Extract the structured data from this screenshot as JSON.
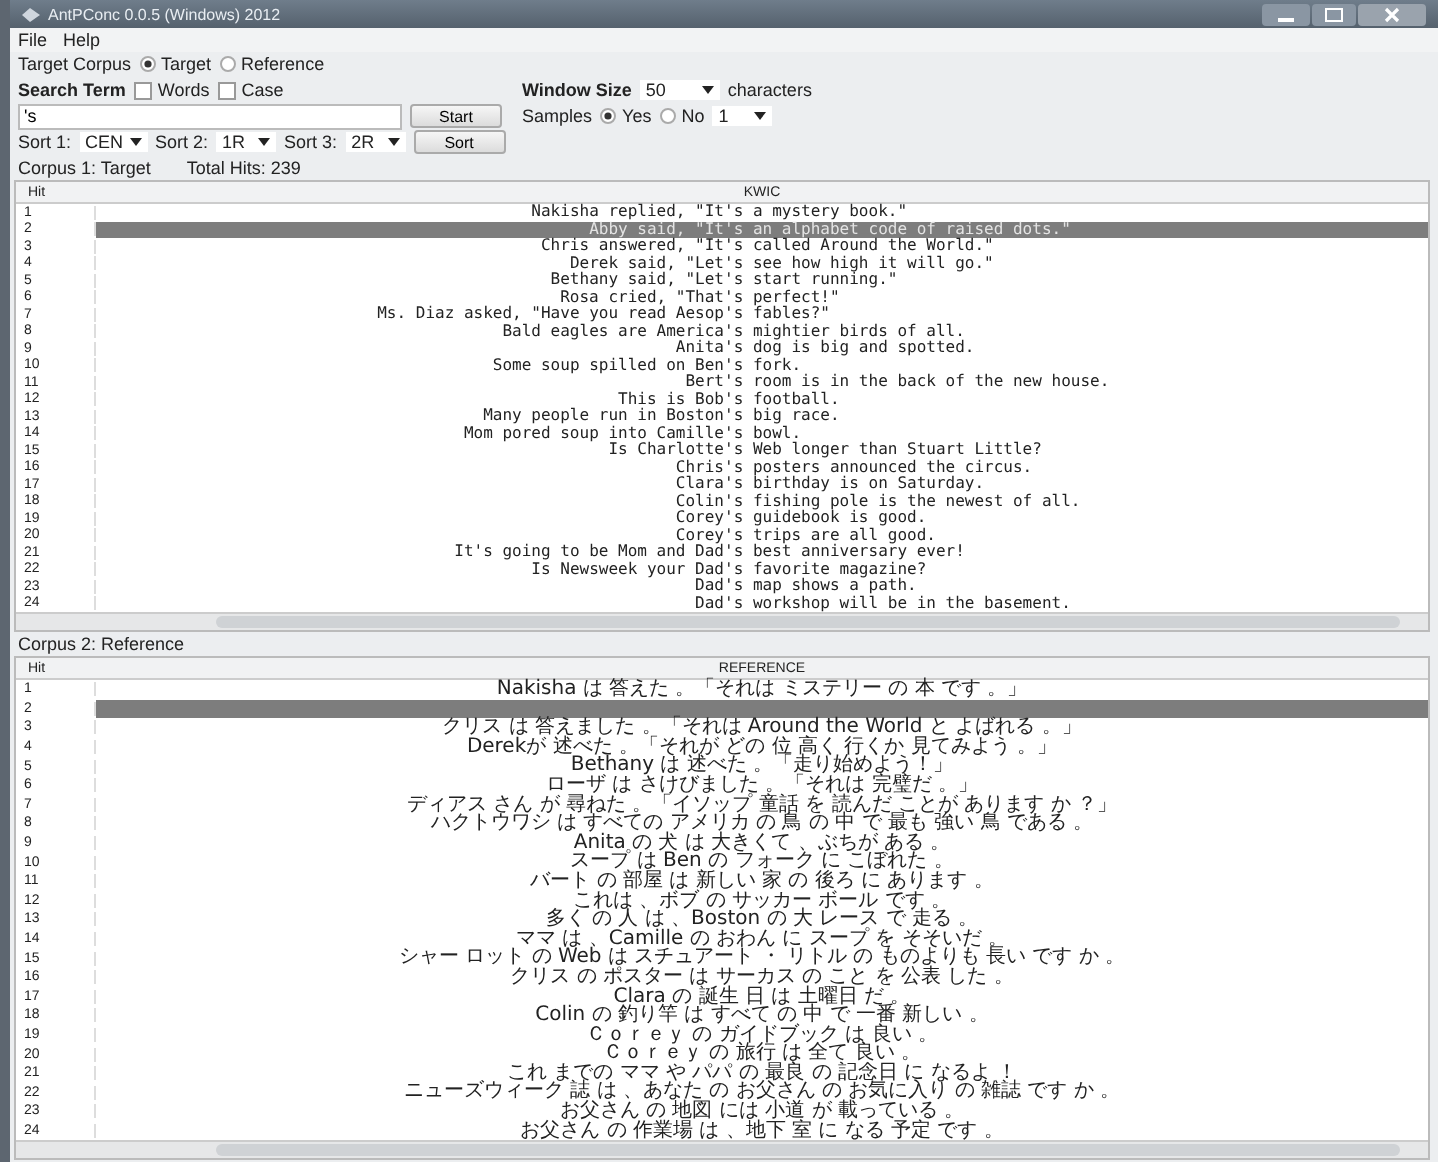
{
  "window": {
    "title": "AntPConc 0.0.5 (Windows) 2012"
  },
  "menu": [
    "File",
    "Help"
  ],
  "target_corpus": {
    "label": "Target Corpus",
    "options": [
      {
        "label": "Target",
        "selected": true
      },
      {
        "label": "Reference",
        "selected": false
      }
    ]
  },
  "search_term": {
    "label": "Search Term",
    "options": [
      {
        "label": "Words",
        "checked": false
      },
      {
        "label": "Case",
        "checked": false
      }
    ],
    "value": "'s"
  },
  "window_size": {
    "label": "Window Size",
    "value": "50",
    "unit": "characters"
  },
  "samples": {
    "label": "Samples",
    "options": [
      {
        "label": "Yes",
        "selected": true
      },
      {
        "label": "No",
        "selected": false
      }
    ],
    "value": "1"
  },
  "start_button": "Start",
  "sort_button": "Sort",
  "sorts": [
    {
      "label": "Sort 1:",
      "value": "CEN"
    },
    {
      "label": "Sort 2:",
      "value": "1R"
    },
    {
      "label": "Sort 3:",
      "value": "2R"
    }
  ],
  "corpus1": {
    "label": "Corpus 1: Target",
    "total_hits": "Total Hits: 239",
    "columns": [
      "Hit",
      "KWIC"
    ],
    "rows": [
      {
        "hit": "1",
        "left": "Nakisha replied, \"It",
        "right": "'s a mystery book.\"",
        "selected": false
      },
      {
        "hit": "2",
        "left": "Abby said, \"It",
        "right": "'s an alphabet code of raised dots.\"",
        "selected": true
      },
      {
        "hit": "3",
        "left": "Chris answered, \"It",
        "right": "'s called Around the World.\"",
        "selected": false
      },
      {
        "hit": "4",
        "left": "Derek said, \"Let",
        "right": "'s see how high it will go.\"",
        "selected": false
      },
      {
        "hit": "5",
        "left": "Bethany said, \"Let",
        "right": "'s start running.\"",
        "selected": false
      },
      {
        "hit": "6",
        "left": "Rosa cried, \"That",
        "right": "'s perfect!\"",
        "selected": false
      },
      {
        "hit": "7",
        "left": "Ms. Diaz asked, \"Have you read Aesop",
        "right": "'s fables?\"",
        "selected": false
      },
      {
        "hit": "8",
        "left": "Bald eagles are America",
        "right": "'s mightier birds of all.",
        "selected": false
      },
      {
        "hit": "9",
        "left": "Anita",
        "right": "'s dog is big and spotted.",
        "selected": false
      },
      {
        "hit": "10",
        "left": "Some soup spilled on Ben",
        "right": "'s fork.",
        "selected": false
      },
      {
        "hit": "11",
        "left": "Bert",
        "right": "'s room is in the back of the new house.",
        "selected": false
      },
      {
        "hit": "12",
        "left": "This is Bob",
        "right": "'s football.",
        "selected": false
      },
      {
        "hit": "13",
        "left": "Many people run in Boston",
        "right": "'s big race.",
        "selected": false
      },
      {
        "hit": "14",
        "left": "Mom pored soup into Camille",
        "right": "'s bowl.",
        "selected": false
      },
      {
        "hit": "15",
        "left": "Is Charlotte",
        "right": "'s Web longer than Stuart Little?",
        "selected": false
      },
      {
        "hit": "16",
        "left": "Chris",
        "right": "'s posters announced the circus.",
        "selected": false
      },
      {
        "hit": "17",
        "left": "Clara",
        "right": "'s birthday is on Saturday.",
        "selected": false
      },
      {
        "hit": "18",
        "left": "Colin",
        "right": "'s fishing pole is the newest of all.",
        "selected": false
      },
      {
        "hit": "19",
        "left": "Corey",
        "right": "'s guidebook is good.",
        "selected": false
      },
      {
        "hit": "20",
        "left": "Corey",
        "right": "'s trips are all good.",
        "selected": false
      },
      {
        "hit": "21",
        "left": "It's going to be Mom and Dad",
        "right": "'s best anniversary ever!",
        "selected": false
      },
      {
        "hit": "22",
        "left": "Is Newsweek your Dad",
        "right": "'s favorite magazine?",
        "selected": false
      },
      {
        "hit": "23",
        "left": "Dad",
        "right": "'s map shows a path.",
        "selected": false
      },
      {
        "hit": "24",
        "left": "Dad",
        "right": "'s workshop will be in the basement.",
        "selected": false
      }
    ]
  },
  "corpus2": {
    "label": "Corpus 2: Reference",
    "columns": [
      "Hit",
      "REFERENCE"
    ],
    "rows": [
      {
        "hit": "1",
        "text": "Nakisha は 答えた 。「それは ミステリー の 本 です 。」",
        "selected": false
      },
      {
        "hit": "2",
        "selected": true
      },
      {
        "hit": "3",
        "text": "クリス は 答えました 。「それは Around the World と よばれる 。」",
        "selected": false
      },
      {
        "hit": "4",
        "text": "Derekが 述べた 。「それが どの 位 高く 行くか 見てみよう 。」",
        "selected": false
      },
      {
        "hit": "5",
        "text": "Bethany は 述べた 。「走り始めよう！」",
        "selected": false
      },
      {
        "hit": "6",
        "text": "ローザ は さけびました 。「それは 完璧だ 。」",
        "selected": false
      },
      {
        "hit": "7",
        "text": "ディアス さん が 尋ねた 。「イソップ 童話 を 読んだ ことが あります か ？」",
        "selected": false
      },
      {
        "hit": "8",
        "text": "ハクトウワシ は すべての アメリカ の 鳥 の 中 で 最も 強い 鳥 である 。",
        "selected": false
      },
      {
        "hit": "9",
        "text": "Anita の 犬 は 大きくて 、ぶちが ある 。",
        "selected": false
      },
      {
        "hit": "10",
        "text": "スープ は Ben の フォーク に こぼれた 。",
        "selected": false
      },
      {
        "hit": "11",
        "text": "バート の 部屋 は 新しい 家 の 後ろ に あります 。",
        "selected": false
      },
      {
        "hit": "12",
        "text": "これは 、ボブ の サッカー ボール です 。",
        "selected": false
      },
      {
        "hit": "13",
        "text": "多く の 人 は 、Boston の 大 レース で 走る 。",
        "selected": false
      },
      {
        "hit": "14",
        "text": "ママ は 、Camille の おわん に スープ を そそいだ 。",
        "selected": false
      },
      {
        "hit": "15",
        "text": "シャー ロット の Web は スチュアート ・ リトル の ものよりも 長い です か 。",
        "selected": false
      },
      {
        "hit": "16",
        "text": "クリス の ポスター は サーカス の こと を 公表 した 。",
        "selected": false
      },
      {
        "hit": "17",
        "text": "Clara の 誕生 日 は 土曜日 だ 。",
        "selected": false
      },
      {
        "hit": "18",
        "text": "Colin の 釣り竿 は すべて の 中 で 一番 新しい 。",
        "selected": false
      },
      {
        "hit": "19",
        "text": "Ｃｏｒｅｙ の ガイドブック は 良い 。",
        "selected": false
      },
      {
        "hit": "20",
        "text": "Ｃｏｒｅｙ の 旅行 は 全て 良い 。",
        "selected": false
      },
      {
        "hit": "21",
        "text": "これ までの ママ や パパ の 最良 の 記念日 に なるよ ！",
        "selected": false
      },
      {
        "hit": "22",
        "text": "ニューズウィーク 誌 は 、あなた の お父さん の お気に入り の 雑誌 です か 。",
        "selected": false
      },
      {
        "hit": "23",
        "text": "お父さん の 地図 には 小道 が 載っている 。",
        "selected": false
      },
      {
        "hit": "24",
        "text": "お父さん の 作業場 は 、地下 室 に なる 予定 です 。",
        "selected": false
      }
    ]
  }
}
